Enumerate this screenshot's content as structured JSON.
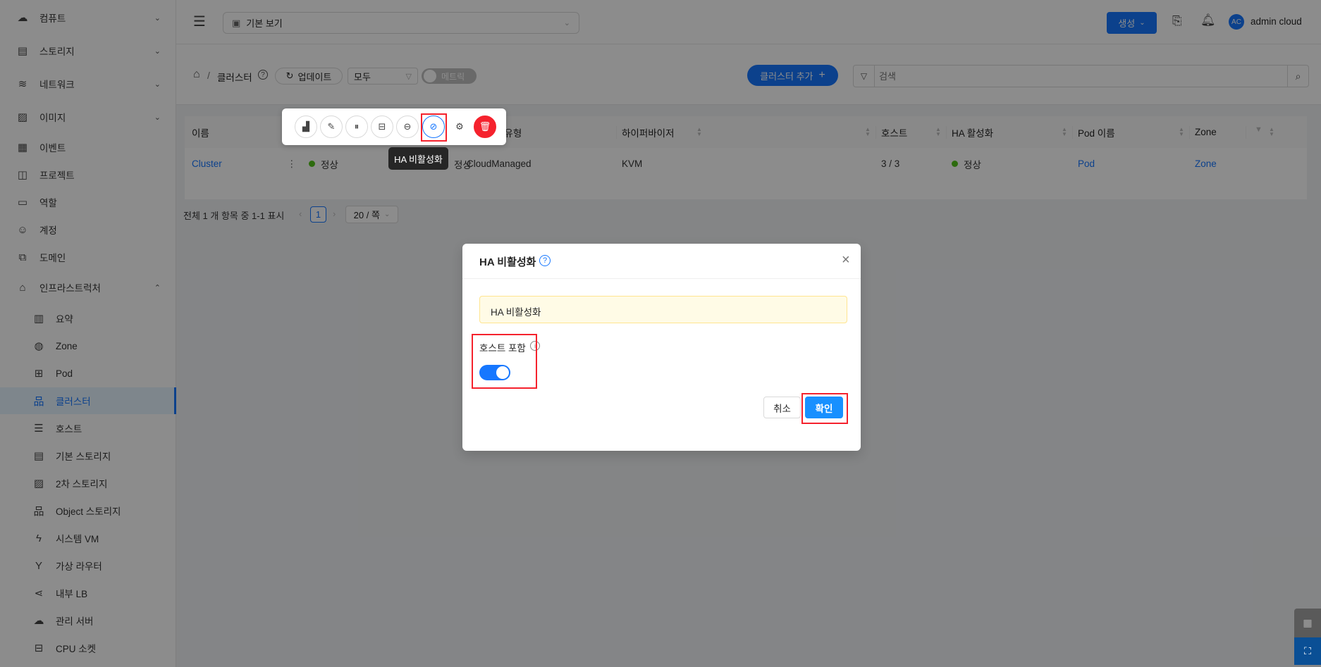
{
  "sidebar": {
    "items": [
      {
        "label": "컴퓨트",
        "icon": "cloud-icon",
        "chevron": "down"
      },
      {
        "label": "스토리지",
        "icon": "storage-icon",
        "chevron": "down"
      },
      {
        "label": "네트워크",
        "icon": "wifi-icon",
        "chevron": "down"
      },
      {
        "label": "이미지",
        "icon": "image-icon",
        "chevron": "down"
      },
      {
        "label": "이벤트",
        "icon": "calendar-icon"
      },
      {
        "label": "프로젝트",
        "icon": "project-icon"
      },
      {
        "label": "역할",
        "icon": "id-card-icon"
      },
      {
        "label": "계정",
        "icon": "users-icon"
      },
      {
        "label": "도메인",
        "icon": "domain-icon"
      },
      {
        "label": "인프라스트럭처",
        "icon": "bank-icon",
        "chevron": "up"
      }
    ],
    "sub_items": [
      {
        "label": "요약",
        "icon": "book-icon"
      },
      {
        "label": "Zone",
        "icon": "globe-icon"
      },
      {
        "label": "Pod",
        "icon": "grid-icon"
      },
      {
        "label": "클러스터",
        "icon": "cluster-icon",
        "active": true
      },
      {
        "label": "호스트",
        "icon": "host-icon"
      },
      {
        "label": "기본 스토리지",
        "icon": "database-icon"
      },
      {
        "label": "2차 스토리지",
        "icon": "picture-icon"
      },
      {
        "label": "Object 스토리지",
        "icon": "object-icon"
      },
      {
        "label": "시스템 VM",
        "icon": "thunder-icon"
      },
      {
        "label": "가상 라우터",
        "icon": "fork-icon"
      },
      {
        "label": "내부 LB",
        "icon": "share-icon"
      },
      {
        "label": "관리 서버",
        "icon": "cloud-server-icon"
      },
      {
        "label": "CPU 소켓",
        "icon": "inbox-icon"
      }
    ]
  },
  "header": {
    "view_select": "기본 보기",
    "create_label": "생성",
    "user_initials": "AC",
    "user_name": "admin cloud"
  },
  "page": {
    "breadcrumb_current": "클러스터",
    "refresh_label": "업데이트",
    "filter_select": "모두",
    "metrics_label": "메트릭",
    "metrics_on": false,
    "add_label": "클러스터 추가",
    "search_placeholder": "검색"
  },
  "table": {
    "columns": [
      "이름",
      "클러스터 유형",
      "하이퍼바이저",
      "호스트",
      "HA 활성화",
      "Pod 이름",
      "Zone"
    ],
    "row": {
      "name": "Cluster",
      "state": "정상",
      "alloc_state": "정상",
      "type": "CloudManaged",
      "hypervisor": "KVM",
      "hosts": "3 / 3",
      "ha": "정상",
      "pod": "Pod",
      "zone": "Zone"
    },
    "status_color": "#52c41a"
  },
  "pagination": {
    "summary": "전체 1 개 항목 중 1-1 표시",
    "current_page": "1",
    "page_size": "20 / 쪽"
  },
  "actions": {
    "icons": [
      "chart-icon",
      "edit-icon",
      "pause-icon",
      "unmanage-icon",
      "minus-circle-icon",
      "eye-invisible-icon",
      "settings-icon",
      "delete-icon"
    ],
    "tooltip": "HA 비활성화"
  },
  "modal": {
    "title": "HA 비활성화",
    "alert": "HA 비활성화",
    "field_label": "호스트 포함",
    "toggle_on": true,
    "cancel_label": "취소",
    "ok_label": "확인"
  },
  "colors": {
    "primary": "#1677ff",
    "danger": "#f5222d",
    "highlight": "#f5222d"
  }
}
